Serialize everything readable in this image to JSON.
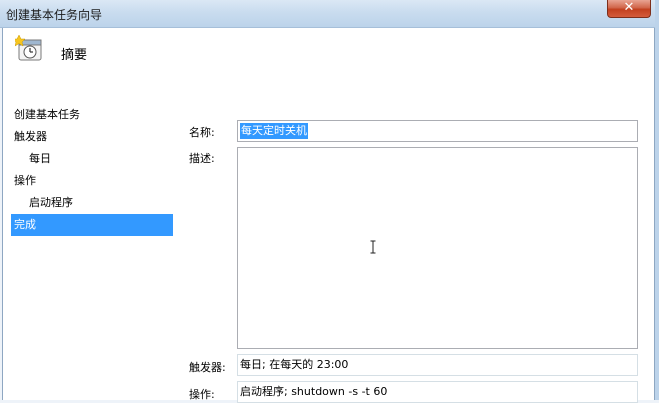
{
  "window": {
    "title": "创建基本任务向导",
    "close_label": "✕"
  },
  "header": {
    "title": "摘要",
    "icon": "task-clock-icon"
  },
  "nav": {
    "items": [
      {
        "label": "创建基本任务"
      },
      {
        "label": "触发器"
      },
      {
        "label": "每日"
      },
      {
        "label": "操作"
      },
      {
        "label": "启动程序"
      },
      {
        "label": "完成"
      }
    ],
    "selected": "完成"
  },
  "form": {
    "name_label": "名称:",
    "name_value": "每天定时关机",
    "desc_label": "描述:",
    "desc_value": "",
    "trigger_label": "触发器:",
    "trigger_value": "每日; 在每天的 23:00",
    "action_label": "操作:",
    "action_value": "启动程序; shutdown -s -t 60"
  },
  "colors": {
    "selection": "#3399ff",
    "close_button": "#c2401f"
  }
}
